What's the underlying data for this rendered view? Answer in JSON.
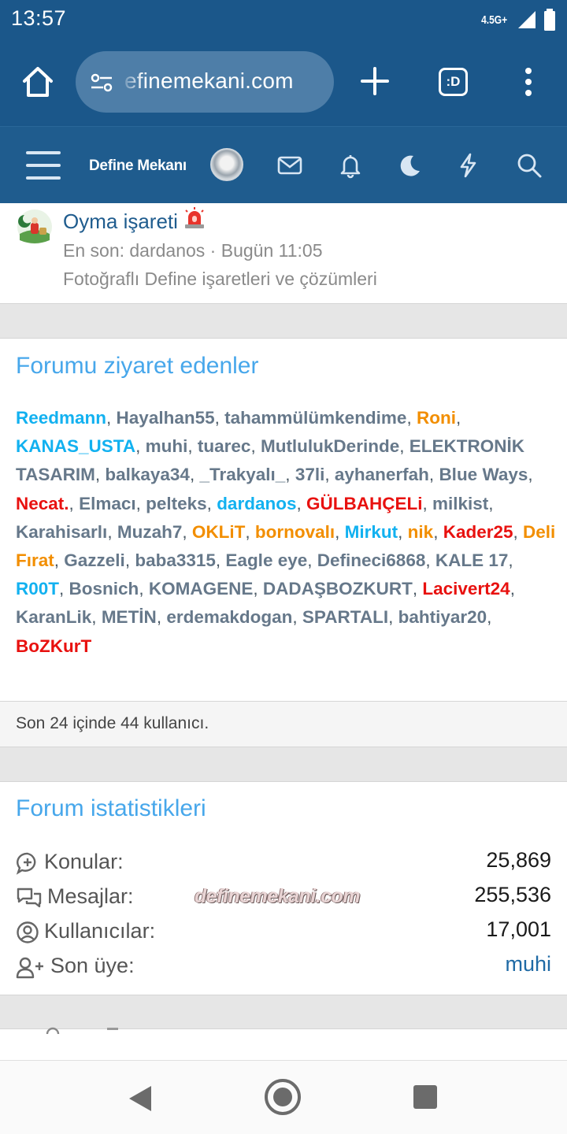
{
  "status_bar": {
    "time": "13:57",
    "network": "4.5G+"
  },
  "browser": {
    "url": "efinemekani.com",
    "tabs_label": ":D"
  },
  "header": {
    "site_name": "Define Mekanı"
  },
  "node": {
    "title": "Oyma işareti",
    "meta": "En son: dardanos · Bugün 11:05",
    "description": "Fotoğraflı Define işaretleri ve çözümleri"
  },
  "visitors": {
    "title": "Forumu ziyaret edenler",
    "users": [
      {
        "name": "Reedmann",
        "color": "blue"
      },
      {
        "name": "Hayalhan55",
        "color": "gray"
      },
      {
        "name": "tahammülümkendime",
        "color": "gray"
      },
      {
        "name": "Roni",
        "color": "orange"
      },
      {
        "name": "KANAS_USTA",
        "color": "blue"
      },
      {
        "name": "muhi",
        "color": "gray"
      },
      {
        "name": "tuarec",
        "color": "gray"
      },
      {
        "name": "MutlulukDerinde",
        "color": "gray"
      },
      {
        "name": "ELEKTRONİK TASARIM",
        "color": "gray"
      },
      {
        "name": "balkaya34",
        "color": "gray"
      },
      {
        "name": "_Trakyalı_",
        "color": "gray"
      },
      {
        "name": "37li",
        "color": "gray"
      },
      {
        "name": "ayhanerfah",
        "color": "gray"
      },
      {
        "name": "Blue Ways",
        "color": "gray"
      },
      {
        "name": "Necat.",
        "color": "red"
      },
      {
        "name": "Elmacı",
        "color": "gray"
      },
      {
        "name": "pelteks",
        "color": "gray"
      },
      {
        "name": "dardanos",
        "color": "blue"
      },
      {
        "name": "GÜLBAHÇELi",
        "color": "red"
      },
      {
        "name": "milkist",
        "color": "gray"
      },
      {
        "name": "Karahisarlı",
        "color": "gray"
      },
      {
        "name": "Muzah7",
        "color": "gray"
      },
      {
        "name": "OKLiT",
        "color": "orange"
      },
      {
        "name": "bornovalı",
        "color": "orange"
      },
      {
        "name": "Mirkut",
        "color": "blue"
      },
      {
        "name": "nik",
        "color": "orange"
      },
      {
        "name": "Kader25",
        "color": "red"
      },
      {
        "name": "Deli Fırat",
        "color": "orange"
      },
      {
        "name": "Gazzeli",
        "color": "gray"
      },
      {
        "name": "baba3315",
        "color": "gray"
      },
      {
        "name": "Eagle eye",
        "color": "gray"
      },
      {
        "name": "Defineci6868",
        "color": "gray"
      },
      {
        "name": "KALE 17",
        "color": "gray"
      },
      {
        "name": "R00T",
        "color": "blue"
      },
      {
        "name": "Bosnich",
        "color": "gray"
      },
      {
        "name": "KOMAGENE",
        "color": "gray"
      },
      {
        "name": "DADAŞBOZKURT",
        "color": "gray"
      },
      {
        "name": "Lacivert24",
        "color": "red"
      },
      {
        "name": "KaranLik",
        "color": "gray"
      },
      {
        "name": "METİN",
        "color": "gray"
      },
      {
        "name": "erdemakdogan",
        "color": "gray"
      },
      {
        "name": "SPARTALI",
        "color": "gray"
      },
      {
        "name": "bahtiyar20",
        "color": "gray"
      },
      {
        "name": "BoZKurT",
        "color": "red"
      }
    ],
    "summary": "Son 24 içinde 44 kullanıcı."
  },
  "stats": {
    "title": "Forum istatistikleri",
    "threads_label": "Konular:",
    "threads_value": "25,869",
    "messages_label": "Mesajlar:",
    "messages_value": "255,536",
    "members_label": "Kullanıcılar:",
    "members_value": "17,001",
    "latest_label": "Son üye:",
    "latest_value": "muhi",
    "watermark": "definemekani.com"
  }
}
